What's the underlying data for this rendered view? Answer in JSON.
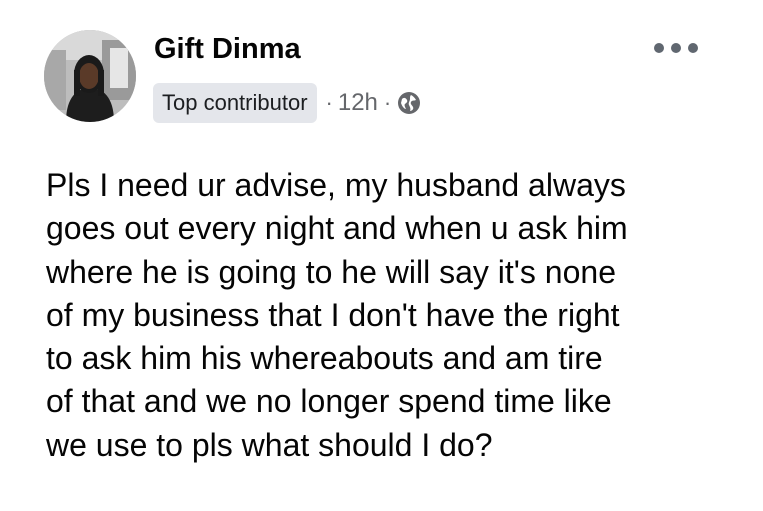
{
  "post": {
    "author": {
      "name": "Gift Dinma",
      "avatar_icon": "profile-photo"
    },
    "badge": "Top contributor",
    "separator": "·",
    "time": "12h",
    "audience_icon": "globe-icon",
    "more_icon": "more-options-icon",
    "text": "Pls I need ur advise, my husband always\ngoes out every night and when u ask him\nwhere he is going to he will say it's none\nof my business that I don't have the right\nto ask him his whereabouts and am tire\nof that and we no longer spend time like\nwe use to pls what should I do?"
  },
  "colors": {
    "badge_bg": "#e4e6eb",
    "meta_text": "#65676b",
    "body_text": "#050505"
  }
}
